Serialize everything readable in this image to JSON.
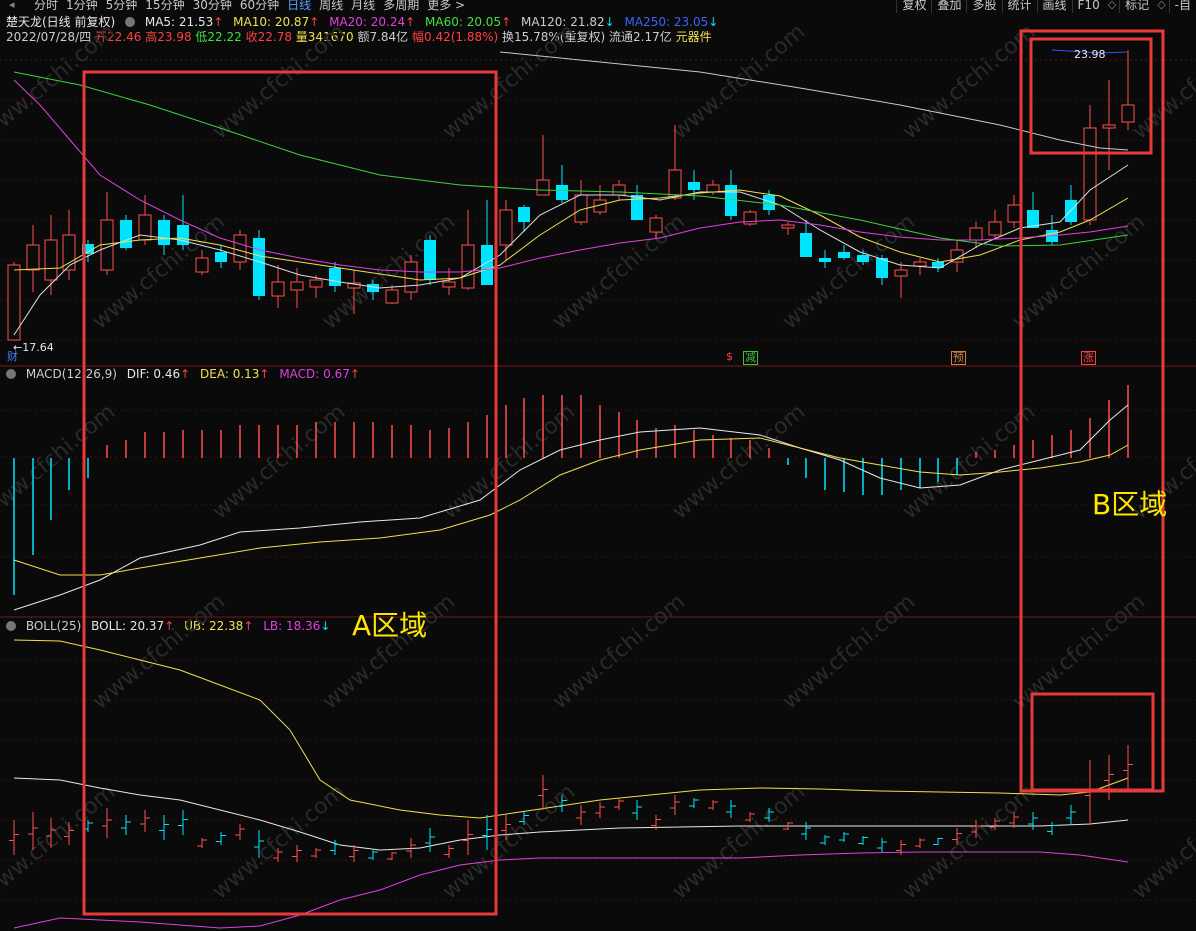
{
  "toolbar": {
    "tabs": [
      "分时",
      "1分钟",
      "5分钟",
      "15分钟",
      "30分钟",
      "60分钟",
      "日线",
      "周线",
      "月线",
      "多周期",
      "更多 >"
    ],
    "active_tab": "日线",
    "right_buttons": [
      "复权",
      "叠加",
      "多股",
      "统计",
      "画线",
      "F10",
      "标记",
      "-自"
    ],
    "window_controls": [
      "◇",
      "◇"
    ]
  },
  "main_panel": {
    "stock_name": "楚天龙(日线 前复权)",
    "ma": [
      {
        "label": "MA5: 21.53",
        "arrow": "↑",
        "color": "#e8e8e8"
      },
      {
        "label": "MA10: 20.87",
        "arrow": "↑",
        "color": "#f0e050"
      },
      {
        "label": "MA20: 20.24",
        "arrow": "↑",
        "color": "#e040e0"
      },
      {
        "label": "MA60: 20.05",
        "arrow": "↑",
        "color": "#40e040"
      },
      {
        "label": "MA120: 21.82",
        "arrow": "↓",
        "color": "#cccccc"
      },
      {
        "label": "MA250: 23.05",
        "arrow": "↓",
        "color": "#4060ff"
      }
    ],
    "quote": {
      "date": "2022/07/28/四",
      "open": "开22.46",
      "high": "高23.98",
      "low": "低22.22",
      "close": "收22.78",
      "volume": "量341670",
      "amount": "额7.84亿",
      "change": "幅0.42(1.88%)",
      "turnover": "换15.78%(重复权)",
      "float": "流通2.17亿",
      "sector": "元器件"
    },
    "high_label": "23.98",
    "low_label": "17.64",
    "markers": [
      {
        "text": "财",
        "color": "#4080ff"
      },
      {
        "text": "$",
        "color": "#ff4040"
      },
      {
        "text": "减",
        "color": "#40c040"
      },
      {
        "text": "预",
        "color": "#d08040"
      },
      {
        "text": "涨",
        "color": "#ff4040"
      }
    ]
  },
  "macd_panel": {
    "title": "MACD(12,26,9)",
    "dif": "DIF: 0.46",
    "dea": "DEA: 0.13",
    "macd": "MACD: 0.67",
    "arrow_up": "↑"
  },
  "boll_panel": {
    "title": "BOLL(25)",
    "boll": "BOLL: 20.37",
    "ub": "UB: 22.38",
    "lb": "LB: 18.36",
    "arrow_up": "↑",
    "arrow_down": "↓"
  },
  "regions": {
    "a_label": "A区域",
    "b_label": "B区域"
  },
  "watermark": "www.cfchi.com",
  "colors": {
    "up": "#ff5050",
    "down": "#00e5ff",
    "annotation": "#e83a3a",
    "label": "#ffe600"
  }
}
